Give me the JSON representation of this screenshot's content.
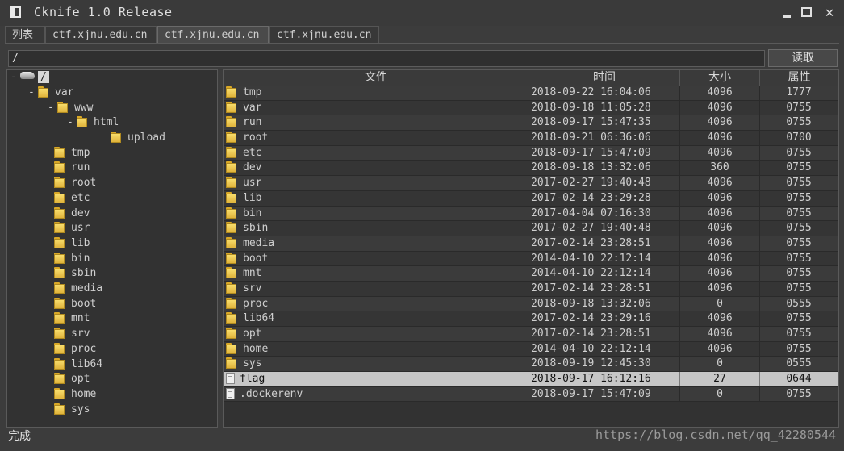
{
  "window": {
    "title": "Cknife 1.0 Release"
  },
  "tabs": [
    "列表",
    "ctf.xjnu.edu.cn",
    "ctf.xjnu.edu.cn",
    "ctf.xjnu.edu.cn"
  ],
  "active_tab": 2,
  "path": {
    "value": "/"
  },
  "read_button": "读取",
  "tree": {
    "root": "/",
    "nodes": [
      {
        "label": "var",
        "expander": "-"
      },
      {
        "label": "www",
        "expander": "-"
      },
      {
        "label": "html",
        "expander": "-"
      },
      {
        "label": "upload",
        "expander": ""
      },
      {
        "label": "tmp",
        "expander": ""
      },
      {
        "label": "run",
        "expander": ""
      },
      {
        "label": "root",
        "expander": ""
      },
      {
        "label": "etc",
        "expander": ""
      },
      {
        "label": "dev",
        "expander": ""
      },
      {
        "label": "usr",
        "expander": ""
      },
      {
        "label": "lib",
        "expander": ""
      },
      {
        "label": "bin",
        "expander": ""
      },
      {
        "label": "sbin",
        "expander": ""
      },
      {
        "label": "media",
        "expander": ""
      },
      {
        "label": "boot",
        "expander": ""
      },
      {
        "label": "mnt",
        "expander": ""
      },
      {
        "label": "srv",
        "expander": ""
      },
      {
        "label": "proc",
        "expander": ""
      },
      {
        "label": "lib64",
        "expander": ""
      },
      {
        "label": "opt",
        "expander": ""
      },
      {
        "label": "home",
        "expander": ""
      },
      {
        "label": "sys",
        "expander": ""
      }
    ]
  },
  "columns": {
    "name": "文件",
    "time": "时间",
    "size": "大小",
    "attr": "属性"
  },
  "files": [
    {
      "name": "tmp",
      "time": "2018-09-22 16:04:06",
      "size": "4096",
      "attr": "1777",
      "type": "folder"
    },
    {
      "name": "var",
      "time": "2018-09-18 11:05:28",
      "size": "4096",
      "attr": "0755",
      "type": "folder"
    },
    {
      "name": "run",
      "time": "2018-09-17 15:47:35",
      "size": "4096",
      "attr": "0755",
      "type": "folder"
    },
    {
      "name": "root",
      "time": "2018-09-21 06:36:06",
      "size": "4096",
      "attr": "0700",
      "type": "folder"
    },
    {
      "name": "etc",
      "time": "2018-09-17 15:47:09",
      "size": "4096",
      "attr": "0755",
      "type": "folder"
    },
    {
      "name": "dev",
      "time": "2018-09-18 13:32:06",
      "size": "360",
      "attr": "0755",
      "type": "folder"
    },
    {
      "name": "usr",
      "time": "2017-02-27 19:40:48",
      "size": "4096",
      "attr": "0755",
      "type": "folder"
    },
    {
      "name": "lib",
      "time": "2017-02-14 23:29:28",
      "size": "4096",
      "attr": "0755",
      "type": "folder"
    },
    {
      "name": "bin",
      "time": "2017-04-04 07:16:30",
      "size": "4096",
      "attr": "0755",
      "type": "folder"
    },
    {
      "name": "sbin",
      "time": "2017-02-27 19:40:48",
      "size": "4096",
      "attr": "0755",
      "type": "folder"
    },
    {
      "name": "media",
      "time": "2017-02-14 23:28:51",
      "size": "4096",
      "attr": "0755",
      "type": "folder"
    },
    {
      "name": "boot",
      "time": "2014-04-10 22:12:14",
      "size": "4096",
      "attr": "0755",
      "type": "folder"
    },
    {
      "name": "mnt",
      "time": "2014-04-10 22:12:14",
      "size": "4096",
      "attr": "0755",
      "type": "folder"
    },
    {
      "name": "srv",
      "time": "2017-02-14 23:28:51",
      "size": "4096",
      "attr": "0755",
      "type": "folder"
    },
    {
      "name": "proc",
      "time": "2018-09-18 13:32:06",
      "size": "0",
      "attr": "0555",
      "type": "folder"
    },
    {
      "name": "lib64",
      "time": "2017-02-14 23:29:16",
      "size": "4096",
      "attr": "0755",
      "type": "folder"
    },
    {
      "name": "opt",
      "time": "2017-02-14 23:28:51",
      "size": "4096",
      "attr": "0755",
      "type": "folder"
    },
    {
      "name": "home",
      "time": "2014-04-10 22:12:14",
      "size": "4096",
      "attr": "0755",
      "type": "folder"
    },
    {
      "name": "sys",
      "time": "2018-09-19 12:45:30",
      "size": "0",
      "attr": "0555",
      "type": "folder"
    },
    {
      "name": "flag",
      "time": "2018-09-17 16:12:16",
      "size": "27",
      "attr": "0644",
      "type": "file",
      "selected": true
    },
    {
      "name": ".dockerenv",
      "time": "2018-09-17 15:47:09",
      "size": "0",
      "attr": "0755",
      "type": "file"
    }
  ],
  "status": "完成",
  "watermark": "https://blog.csdn.net/qq_42280544"
}
